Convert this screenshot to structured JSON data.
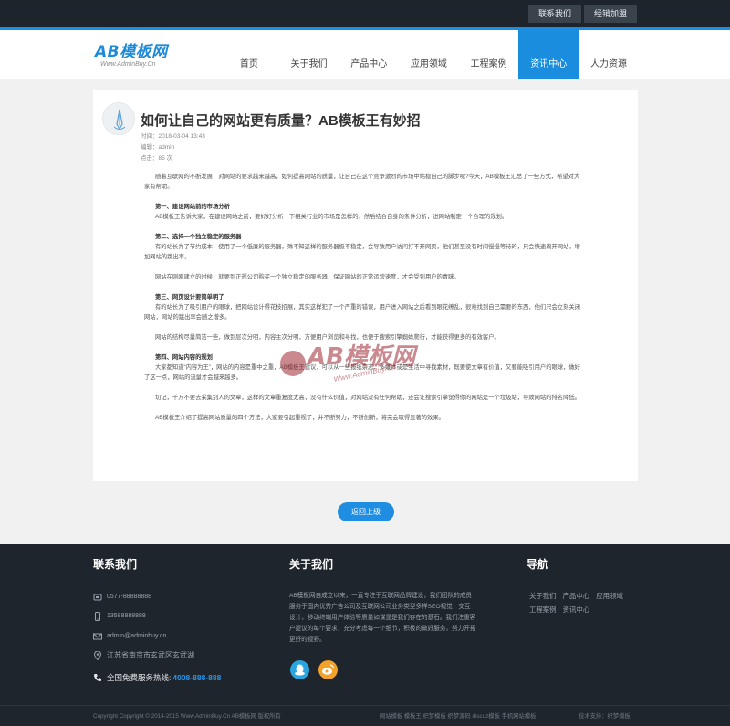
{
  "topbar": {
    "contact_label": "联系我们",
    "franchise_label": "经销加盟"
  },
  "logo": {
    "main": "AB模板网",
    "sub": "Www.AdminBuy.Cn"
  },
  "nav": {
    "items": [
      {
        "label": "首页"
      },
      {
        "label": "关于我们"
      },
      {
        "label": "产品中心"
      },
      {
        "label": "应用领域"
      },
      {
        "label": "工程案例"
      },
      {
        "label": "资讯中心"
      },
      {
        "label": "人力资源"
      }
    ],
    "active_index": 5
  },
  "article": {
    "title": "如何让自己的网站更有质量？AB模板王有妙招",
    "time": "时间：2018-03-04 13:43",
    "editor": "编辑：admin",
    "views": "点击：85 次",
    "paragraphs": [
      "随着互联网的不断发展，对网站的要求越来越高，如何提高网站的质量，让自己在这个竞争激烈的市场中站稳自己的脚步呢?今天，AB模板王汇总了一些方式，希望对大家有帮助。",
      "第一、建设网站前的市场分析",
      "AB模板王告诉大家，在建设网站之前，要好好分析一下相关行业的市场是怎样的，然后结合自身的条件分析，进网站制定一个合理的规划。",
      "第二、选择一个独立稳定的服务器",
      "有的站长为了节约成本，使用了一个低廉的服务器，殊不知这样的服务器极不稳定，会导致用户访问打不开网页，他们甚至没有时间慢慢等待的，只会快速离开网站，增加网站的跳出率。",
      "网站在刚刚建立的时候，就要到正规公司购买一个独立稳定的服务器，保证网站的正常运营速度，才会受到用户的青睐。",
      "第三、网页设计要简单明了",
      "有的站长为了吸引用户的眼球，把网站设计得花枝招展，其实这样犯了一个严重的错误，用户进入网站之后看到眼花缭乱，很难找到自己需要的东西，他们只会立刻关闭网站，网站的跳出率会随之增多。",
      "网站的结构尽量简洁一些，做到层次分明，内容主次分明，方便用户浏览和寻找，也便于搜索引擎蜘蛛爬行，才能获得更多的有效客户。",
      "第四、网站内容的规划",
      "大家都知道“内容为王”，网站的内容是重中之重，AB模板王建议，可以从一些报纸杂志、多媒体或是生活中寻找素材，既要使文章有价值，又要能吸引用户的眼球，做好了这一点，网站的流量才会越来越多。",
      "切记，千万不要去采集别人的文章，这样的文章重复度太高，没有什么价值，对网站没有任何帮助，还会让搜索引擎觉得你的网站是一个垃圾站，导致网站的排名降低。",
      "AB模板王介绍了提高网站质量的四个方法，大家要引起重视了，并不断努力，不断创新，将完会取得显著的效果。"
    ]
  },
  "watermark": {
    "main": "AB模板网",
    "sub": "Www.AdminBuy.Cn"
  },
  "back_button": "返回上级",
  "footer": {
    "contact_title": "联系我们",
    "phone": "0577-88888888",
    "mobile": "13588888888",
    "email": "admin@adminbuy.cn",
    "address": "江苏省南京市玄武区玄武湖",
    "hotline_label": "全国免费服务热线:",
    "hotline_number": "4008-888-888",
    "about_title": "关于我们",
    "about_text": "AB模板网自成立以来，一直专注于互联网品牌建设，我们团队的成员服务于国内优秀广告公司及互联网公司业务类型多样SEO视觉，交互设计，移动终端用户体验等质量如谋显是我们存在的基石。我们注重客户提议的每个要求，充分考虑每一个细节，积极的做好服务，努力开拓更好的视野。",
    "nav_title": "导航",
    "nav_row1": [
      "关于我们",
      "产品中心",
      "应用领域"
    ],
    "nav_row2": [
      "工程案例",
      "资讯中心"
    ],
    "copyright": "Copyright Copyright © 2014-2015 Www.AdminBuy.Cn AB模板网 版权所有",
    "bottom_links": "网站模板 模板王 织梦模板 织梦源码 discuz模板 手机网站模板",
    "bottom_right": "技术支持：织梦模板"
  },
  "icons": {
    "phone": "phone-icon",
    "mobile": "mobile-icon",
    "email": "email-icon",
    "location": "location-icon",
    "hotline": "hotline-icon",
    "qq": "qq-icon",
    "weibo": "weibo-icon"
  },
  "colors": {
    "accent": "#1c8de3",
    "footer_bg": "#1f252c",
    "topbar_bg": "#1e242b",
    "watermark": "#9d2a32"
  }
}
